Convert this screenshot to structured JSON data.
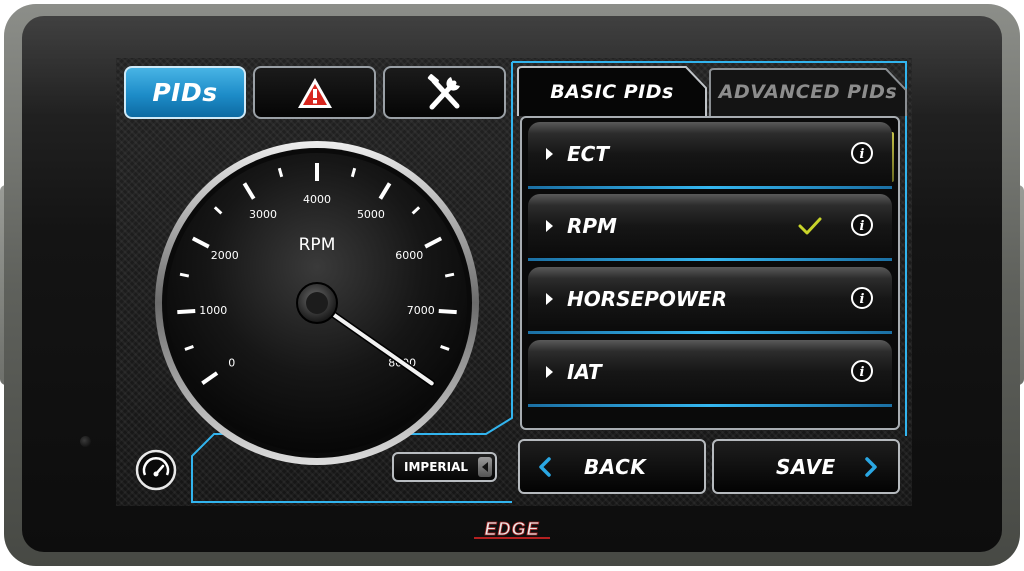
{
  "device": {
    "brand_logo": "EDGE"
  },
  "top_tabs": [
    {
      "label": "PIDs",
      "active": true
    },
    {
      "icon": "warning-icon",
      "active": false
    },
    {
      "icon": "tools-icon",
      "active": false
    }
  ],
  "gauge": {
    "title": "RPM",
    "tick_labels": [
      "0",
      "1000",
      "2000",
      "3000",
      "4000",
      "5000",
      "6000",
      "7000",
      "8000"
    ],
    "value": 8000,
    "min": 0,
    "max": 8000,
    "units_button": "IMPERIAL",
    "mode_icon": "gauge-icon"
  },
  "pid_panel": {
    "tabs": [
      {
        "label": "BASIC PIDs",
        "active": true
      },
      {
        "label": "ADVANCED PIDs",
        "active": false
      }
    ],
    "items": [
      {
        "label": "ECT",
        "selected": false
      },
      {
        "label": "RPM",
        "selected": true
      },
      {
        "label": "HORSEPOWER",
        "selected": false
      },
      {
        "label": "IAT",
        "selected": false
      }
    ]
  },
  "nav": {
    "back_label": "BACK",
    "save_label": "SAVE"
  },
  "colors": {
    "accent": "#2aa7e3",
    "check": "#c8d42a",
    "frame": "#32b4ee"
  }
}
